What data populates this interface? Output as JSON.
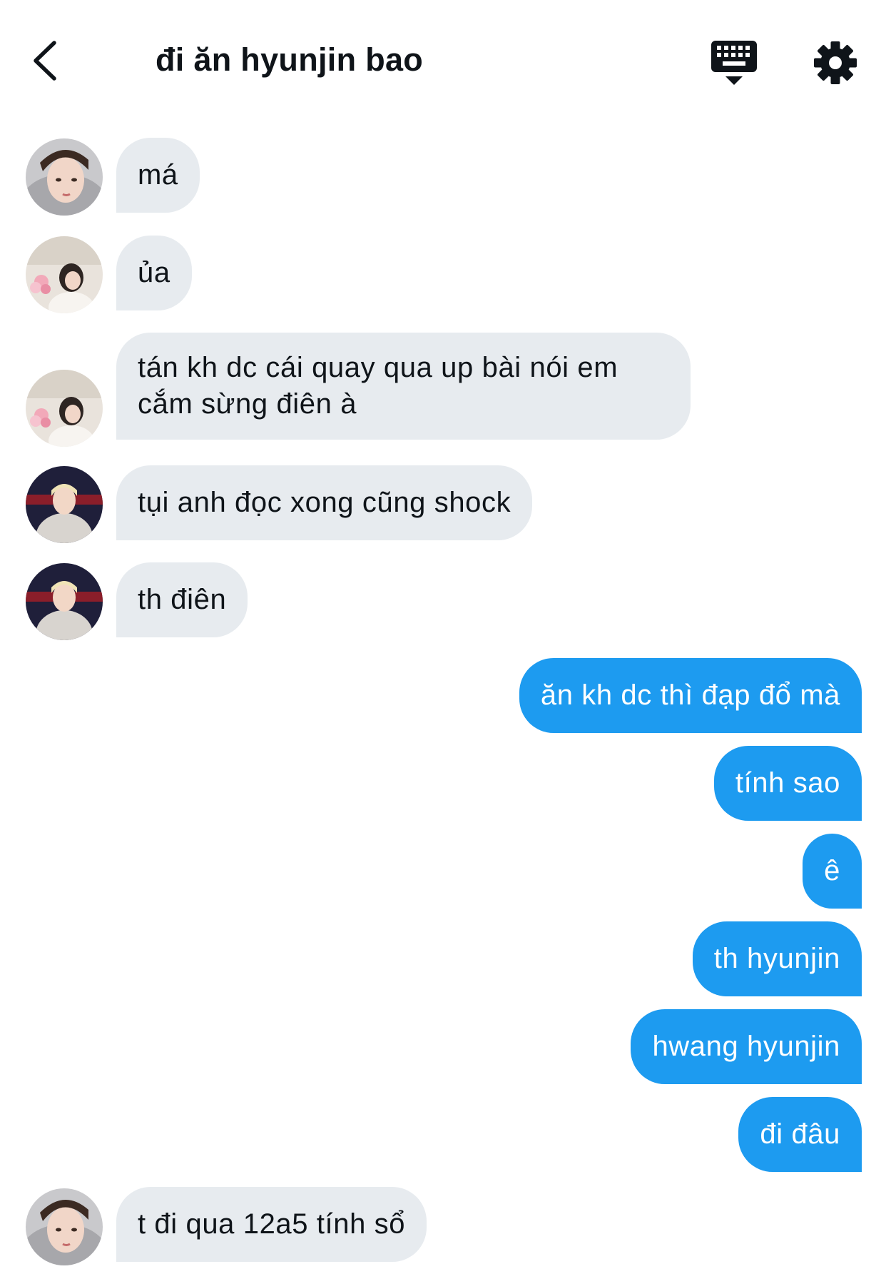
{
  "header": {
    "title": "đi ăn hyunjin bao",
    "back_icon": "chevron-left-icon",
    "keyboard_icon": "keyboard-icon",
    "settings_icon": "gear-icon"
  },
  "colors": {
    "accent": "#1d9bf0",
    "incoming_bubble": "#e7ebef",
    "text": "#0f1419"
  },
  "messages": [
    {
      "direction": "in",
      "avatar": "avatar-girl-grey-hood",
      "text": "má"
    },
    {
      "direction": "in",
      "avatar": "avatar-girl-flowers",
      "text": "ủa"
    },
    {
      "direction": "in",
      "avatar": "avatar-girl-flowers",
      "text": "tán kh dc cái quay qua up bài nói em cắm sừng điên à"
    },
    {
      "direction": "in",
      "avatar": "avatar-boy-blond",
      "text": "tụi anh đọc xong cũng shock"
    },
    {
      "direction": "in",
      "avatar": "avatar-boy-blond",
      "text": "th điên"
    },
    {
      "direction": "out",
      "text": "ăn kh dc thì đạp đổ mà"
    },
    {
      "direction": "out",
      "text": "tính sao"
    },
    {
      "direction": "out",
      "text": "ê"
    },
    {
      "direction": "out",
      "text": "th hyunjin"
    },
    {
      "direction": "out",
      "text": "hwang hyunjin"
    },
    {
      "direction": "out",
      "text": "đi đâu"
    },
    {
      "direction": "in",
      "avatar": "avatar-girl-grey-hood",
      "text": "t đi qua 12a5 tính sổ"
    }
  ]
}
